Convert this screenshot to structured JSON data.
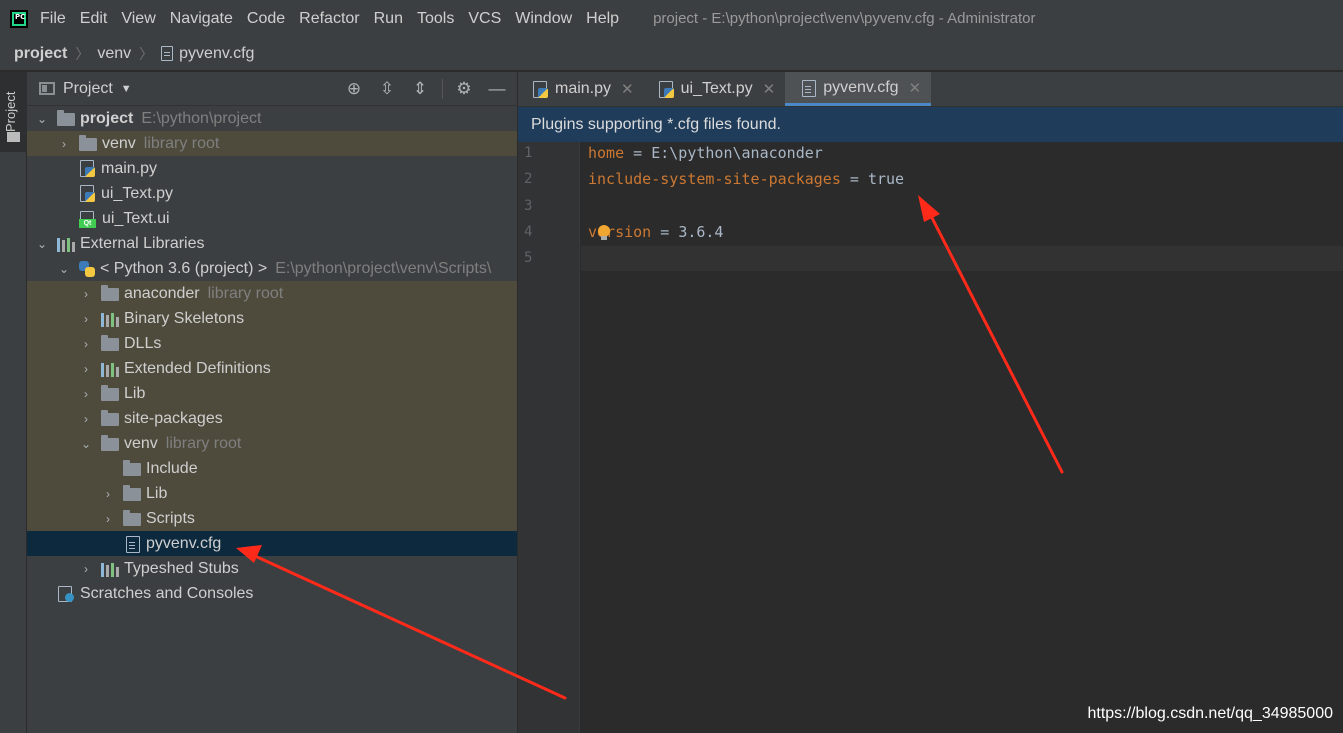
{
  "menubar": {
    "items": [
      "File",
      "Edit",
      "View",
      "Navigate",
      "Code",
      "Refactor",
      "Run",
      "Tools",
      "VCS",
      "Window",
      "Help"
    ],
    "title": "project - E:\\python\\project\\venv\\pyvenv.cfg - Administrator"
  },
  "breadcrumb": {
    "items": [
      "project",
      "venv",
      "pyvenv.cfg"
    ]
  },
  "left_stripe": {
    "label": "Project"
  },
  "project_panel": {
    "title": "Project"
  },
  "tree": {
    "project": {
      "label": "project",
      "hint": "E:\\python\\project"
    },
    "venv": {
      "label": "venv",
      "hint": "library root"
    },
    "main_py": {
      "label": "main.py"
    },
    "ui_text_py": {
      "label": "ui_Text.py"
    },
    "ui_text_ui": {
      "label": "ui_Text.ui"
    },
    "external_libraries": {
      "label": "External Libraries"
    },
    "python": {
      "label": "< Python 3.6 (project) >",
      "hint": "E:\\python\\project\\venv\\Scripts\\"
    },
    "anaconder": {
      "label": "anaconder",
      "hint": "library root"
    },
    "binary_skeletons": {
      "label": "Binary Skeletons"
    },
    "dlls": {
      "label": "DLLs"
    },
    "extended_definitions": {
      "label": "Extended Definitions"
    },
    "lib": {
      "label": "Lib"
    },
    "site_packages": {
      "label": "site-packages"
    },
    "venv2": {
      "label": "venv",
      "hint": "library root"
    },
    "include": {
      "label": "Include"
    },
    "lib2": {
      "label": "Lib"
    },
    "scripts": {
      "label": "Scripts"
    },
    "pyvenv_cfg": {
      "label": "pyvenv.cfg"
    },
    "typeshed_stubs": {
      "label": "Typeshed Stubs"
    },
    "scratches": {
      "label": "Scratches and Consoles"
    }
  },
  "tabs": [
    {
      "label": "main.py"
    },
    {
      "label": "ui_Text.py"
    },
    {
      "label": "pyvenv.cfg",
      "active": true
    }
  ],
  "banner": {
    "text": "Plugins supporting *.cfg files found."
  },
  "editor": {
    "lines": [
      {
        "num": "1",
        "key": "home",
        "eq": " = ",
        "value": "E:\\python\\anaconder"
      },
      {
        "num": "2",
        "key": "include-system-site-packages",
        "eq": " = ",
        "value": "true"
      },
      {
        "num": "3",
        "key": "",
        "eq": "",
        "value": ""
      },
      {
        "num": "4",
        "key": "version",
        "eq": " = ",
        "value": "3.6.4"
      },
      {
        "num": "5",
        "key": "",
        "eq": "",
        "value": ""
      }
    ]
  },
  "watermark": "https://blog.csdn.net/qq_34985000",
  "colors": {
    "key": "#cc7832",
    "value": "#a9b7c6",
    "selection": "#0d293e",
    "banner": "#1f3c5a",
    "annotation_arrow": "#ff2a1a"
  }
}
